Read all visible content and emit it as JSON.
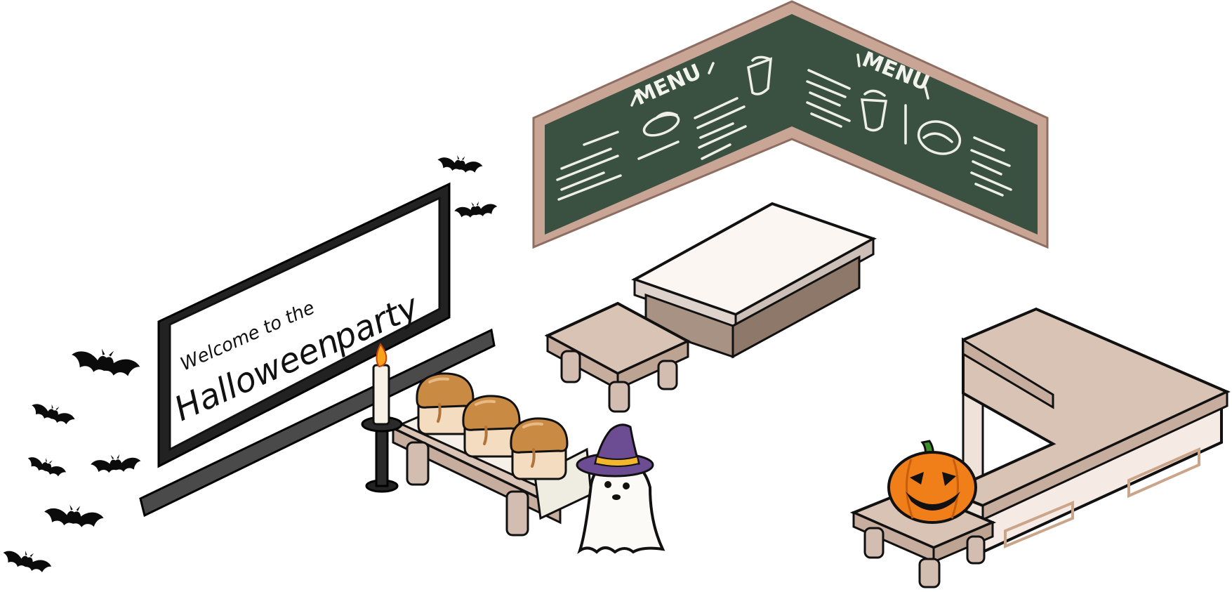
{
  "scene": {
    "welcome_sign": {
      "line1": "Welcome to the",
      "line2": "Halloween",
      "line3": "party"
    },
    "menu_board": {
      "left_heading": "MENU",
      "right_heading": "MENU"
    },
    "colors": {
      "chalkboard": "#3a5040",
      "chalkboard_frame": "#c9a596",
      "wood_top": "#d8c3b5",
      "wood_side": "#c7ad9d",
      "leg": "#d3bdb0",
      "pumpkin": "#f07f1a",
      "bread": "#c98a43",
      "candle_flame": "#f7a21a",
      "witch_hat": "#6c4c92",
      "outline": "#111111"
    },
    "items": [
      "bat-icon",
      "welcome-sign",
      "candle-holder",
      "bread-table",
      "ghost-with-witch-hat",
      "chalkboard-menu",
      "stool",
      "long-table",
      "l-shaped-counter",
      "jack-o-lantern"
    ]
  }
}
